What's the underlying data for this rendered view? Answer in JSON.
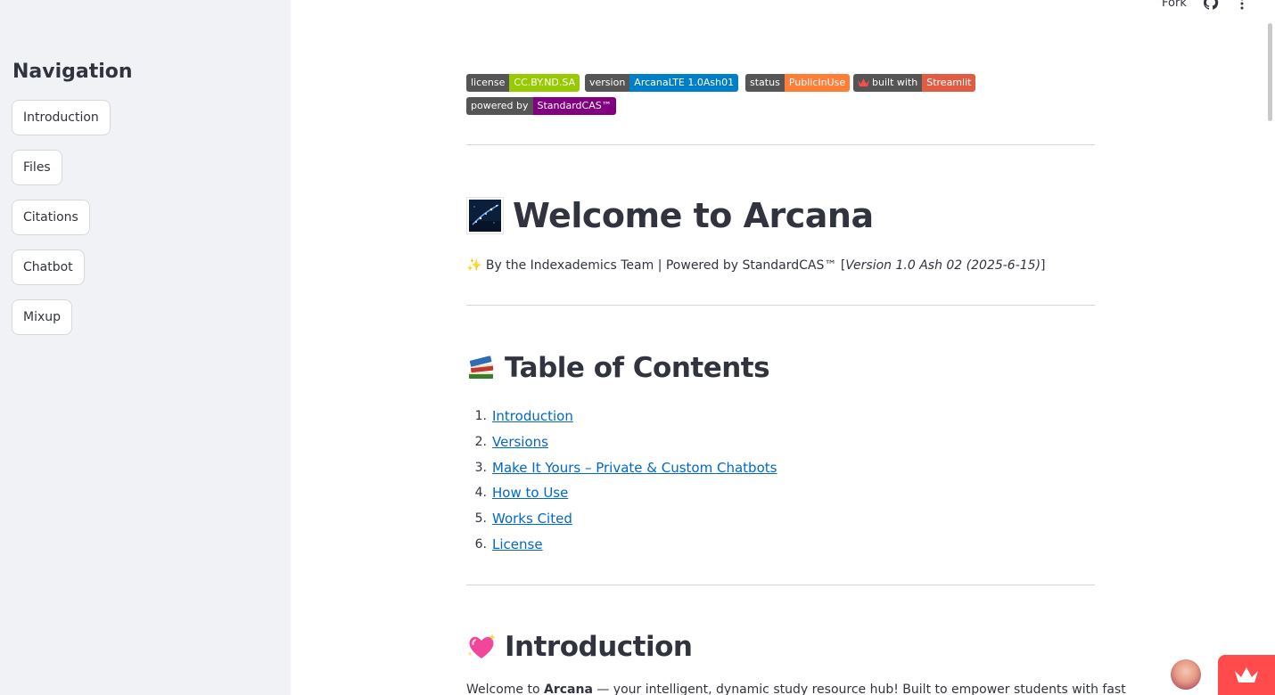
{
  "sidebar": {
    "title": "Navigation",
    "items": [
      {
        "label": "Introduction"
      },
      {
        "label": "Files"
      },
      {
        "label": "Citations"
      },
      {
        "label": "Chatbot"
      },
      {
        "label": "Mixup"
      }
    ]
  },
  "header": {
    "fork_label": "Fork",
    "icons": [
      "github-icon",
      "kebab-menu-icon"
    ]
  },
  "badges": [
    {
      "key": "license",
      "value": "CC.BY.ND.SA",
      "color": "#97ca00"
    },
    {
      "key": "version",
      "value": "ArcanaLTE 1.0Ash01",
      "color": "#007ec6"
    },
    {
      "key": "status",
      "value": "PublicInUse",
      "color": "#fe7d37"
    },
    {
      "key": "built with",
      "value": "Streamlit",
      "color": "#e05d44",
      "icon": "streamlit-crown-icon"
    },
    {
      "key": "powered by",
      "value": "StandardCAS™",
      "color": "#800080"
    }
  ],
  "page": {
    "title": "Welcome to Arcana",
    "byline_prefix": "✨ By the Indexademics Team | Powered by StandardCAS™ [",
    "byline_version": "Version 1.0 Ash 02 (2025-6-15)",
    "byline_suffix": "]"
  },
  "toc": {
    "heading": "Table of Contents",
    "items": [
      {
        "num": "1.",
        "label": "Introduction"
      },
      {
        "num": "2.",
        "label": "Versions"
      },
      {
        "num": "3.",
        "label": "Make It Yours – Private & Custom Chatbots"
      },
      {
        "num": "4.",
        "label": "How to Use"
      },
      {
        "num": "5.",
        "label": "Works Cited"
      },
      {
        "num": "6.",
        "label": "License"
      }
    ]
  },
  "introduction": {
    "heading": "Introduction",
    "text_prefix": "Welcome to ",
    "text_bold": "Arcana",
    "text_suffix": " — your intelligent, dynamic study resource hub! Built to empower students with fast"
  },
  "colors": {
    "sidebar_bg": "#f0f2f6",
    "link": "#0068c9",
    "streamlit_red": "#ff4b4b"
  }
}
